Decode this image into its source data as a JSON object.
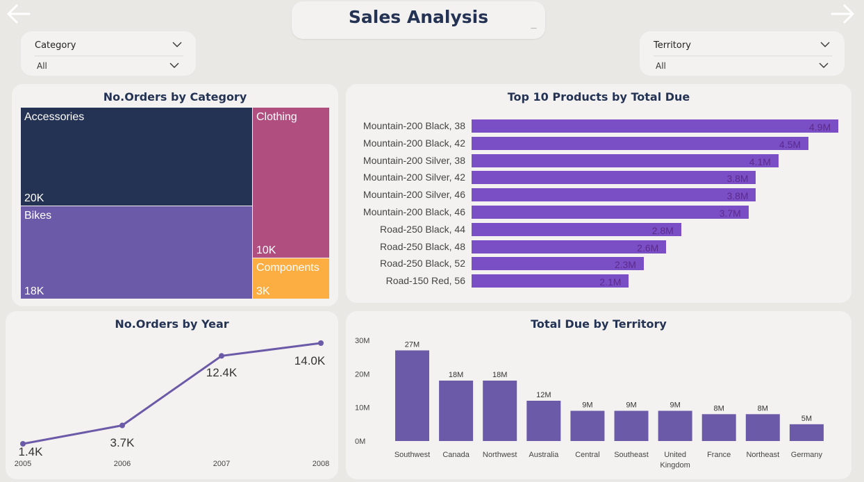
{
  "header": {
    "title": "Sales Analysis",
    "title_mark": "—"
  },
  "nav": {
    "back": "back-arrow-icon",
    "forward": "forward-arrow-icon"
  },
  "slicers": {
    "category": {
      "label": "Category",
      "value": "All"
    },
    "territory": {
      "label": "Territory",
      "value": "All"
    }
  },
  "treemap": {
    "title": "No.Orders by Category",
    "tiles": [
      {
        "name": "Accessories",
        "value_label": "20K",
        "color": "#243353"
      },
      {
        "name": "Bikes",
        "value_label": "18K",
        "color": "#6b5aa8"
      },
      {
        "name": "Clothing",
        "value_label": "10K",
        "color": "#b04e80"
      },
      {
        "name": "Components",
        "value_label": "3K",
        "color": "#fdae42"
      }
    ]
  },
  "top_products": {
    "title": "Top 10 Products by Total Due",
    "bar_color": "#7a4fc6",
    "items": [
      {
        "label": "Mountain-200 Black, 38",
        "value": 4.9,
        "value_label": "4.9M"
      },
      {
        "label": "Mountain-200 Black, 42",
        "value": 4.5,
        "value_label": "4.5M"
      },
      {
        "label": "Mountain-200 Silver, 38",
        "value": 4.1,
        "value_label": "4.1M"
      },
      {
        "label": "Mountain-200 Silver, 42",
        "value": 3.8,
        "value_label": "3.8M"
      },
      {
        "label": "Mountain-200 Silver, 46",
        "value": 3.8,
        "value_label": "3.8M"
      },
      {
        "label": "Mountain-200 Black, 46",
        "value": 3.7,
        "value_label": "3.7M"
      },
      {
        "label": "Road-250 Black, 44",
        "value": 2.8,
        "value_label": "2.8M"
      },
      {
        "label": "Road-250 Black, 48",
        "value": 2.6,
        "value_label": "2.6M"
      },
      {
        "label": "Road-250 Black, 52",
        "value": 2.3,
        "value_label": "2.3M"
      },
      {
        "label": "Road-150 Red, 56",
        "value": 2.1,
        "value_label": "2.1M"
      }
    ]
  },
  "orders_by_year": {
    "title": "No.Orders by Year",
    "line_color": "#6b5aa8"
  },
  "territory_chart": {
    "title": "Total Due by Territory",
    "bar_color": "#6b5aa8"
  },
  "chart_data": [
    {
      "type": "bar",
      "orientation": "horizontal",
      "title": "Top 10 Products by Total Due",
      "categories": [
        "Mountain-200 Black, 38",
        "Mountain-200 Black, 42",
        "Mountain-200 Silver, 38",
        "Mountain-200 Silver, 42",
        "Mountain-200 Silver, 46",
        "Mountain-200 Black, 46",
        "Road-250 Black, 44",
        "Road-250 Black, 48",
        "Road-250 Black, 52",
        "Road-150 Red, 56"
      ],
      "values": [
        4.9,
        4.5,
        4.1,
        3.8,
        3.8,
        3.7,
        2.8,
        2.6,
        2.3,
        2.1
      ],
      "data_labels": [
        "4.9M",
        "4.5M",
        "4.1M",
        "3.8M",
        "3.8M",
        "3.7M",
        "2.8M",
        "2.6M",
        "2.3M",
        "2.1M"
      ]
    },
    {
      "type": "line",
      "title": "No.Orders by Year",
      "x": [
        "2005",
        "2006",
        "2007",
        "2008"
      ],
      "values": [
        1.4,
        3.7,
        12.4,
        14.0
      ],
      "data_labels": [
        "1.4K",
        "3.7K",
        "12.4K",
        "14.0K"
      ],
      "grid": false
    },
    {
      "type": "bar",
      "title": "Total Due by Territory",
      "categories": [
        "Southwest",
        "Canada",
        "Northwest",
        "Australia",
        "Central",
        "Southeast",
        "United Kingdom",
        "France",
        "Northeast",
        "Germany"
      ],
      "values": [
        27,
        18,
        18,
        12,
        9,
        9,
        9,
        8,
        8,
        5
      ],
      "data_labels": [
        "27M",
        "18M",
        "18M",
        "12M",
        "9M",
        "9M",
        "9M",
        "8M",
        "8M",
        "5M"
      ],
      "yticks": [
        "0M",
        "10M",
        "20M",
        "30M"
      ],
      "ylim": [
        0,
        30
      ],
      "grid": false
    }
  ]
}
